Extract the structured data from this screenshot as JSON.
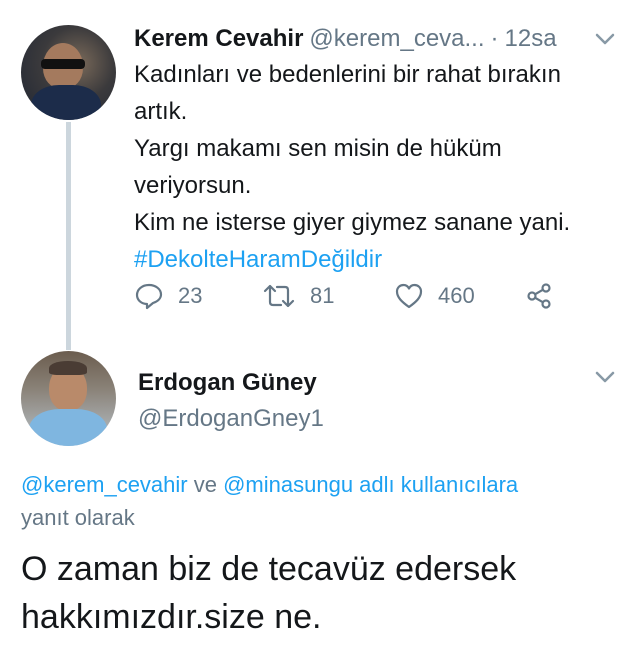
{
  "tweet": {
    "author_name": "Kerem Cevahir",
    "author_handle": "@kerem_ceva...",
    "separator": "·",
    "time": "12sa",
    "text_lines": [
      "Kadınları ve bedenlerini bir rahat bırakın",
      "artık.",
      "Yargı makamı sen misin de hüküm",
      "veriyorsun.",
      "Kim ne isterse giyer giymez sanane yani."
    ],
    "hashtag": "#DekolteHaramDeğildir",
    "reply_count": "23",
    "retweet_count": "81",
    "like_count": "460",
    "icons": {
      "reply": "reply-icon",
      "retweet": "retweet-icon",
      "like": "heart-icon",
      "share": "share-icon",
      "menu": "chevron-down-icon"
    }
  },
  "reply": {
    "author_name": "Erdogan Güney",
    "author_handle": "@ErdoganGney1",
    "context": {
      "mention1": "@kerem_cevahir",
      "connector": " ve ",
      "mention2": "@minasungu",
      "suffix": " adlı kullanıcılara",
      "line2": "yanıt olarak"
    },
    "text_lines": [
      "O zaman biz de tecavüz edersek",
      "hakkımızdır.size ne."
    ]
  },
  "colors": {
    "text": "#14171a",
    "secondary": "#657786",
    "link": "#1da1f2",
    "thread_line": "#ccd6dd"
  }
}
